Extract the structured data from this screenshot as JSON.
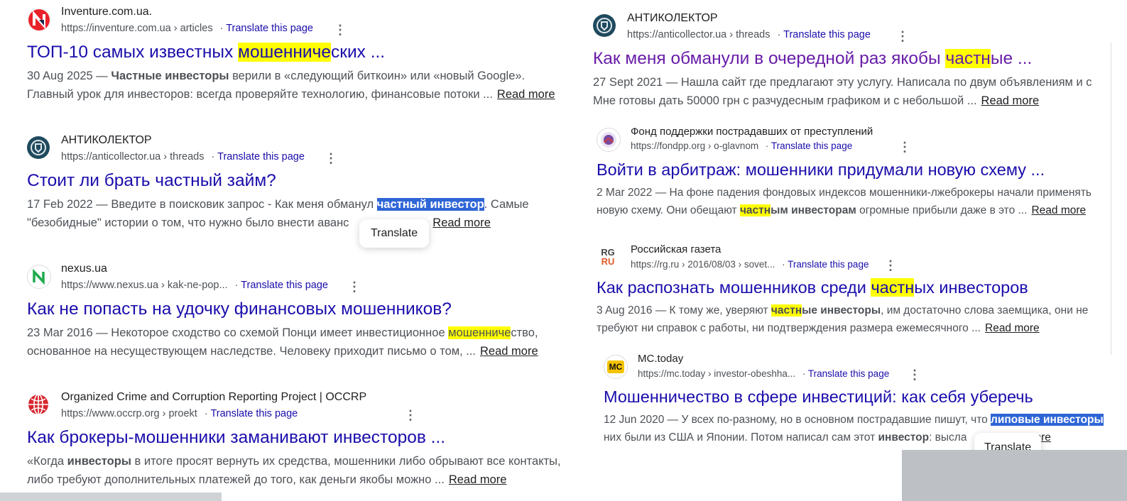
{
  "left": [
    {
      "site": "Inventure.com.ua.",
      "url": "https://inventure.com.ua › articles",
      "translate": "Translate this page",
      "title_pre": "ТОП-10 самых известных ",
      "title_hl": "мошенниче",
      "title_post": "ских ...",
      "s1_pre": "30 Aug 2025 — ",
      "s1_bold": "Частные инвесторы",
      "s1_post": " верили в «следующий биткоин» или «новый Google».",
      "s2": "Главный урок для инвесторов: всегда проверяйте технологию, финансовые потоки ...",
      "read_more": "Read more"
    },
    {
      "site": "АНТИКОЛЕКТОР",
      "url": "https://anticollector.ua › threads",
      "translate": "Translate this page",
      "title": "Стоит ли брать частный займ?",
      "s1_pre": "17 Feb 2022 — Введите в поисковик запрос - Как меня обманул ",
      "s1_sel": "частный инвестор",
      "s1_post": ". Самые",
      "s2": "\"безобидные\" истории о том, что нужно было внести аванс",
      "s2_tail": "ние ...",
      "read_more": "Read more",
      "tooltip": "Translate"
    },
    {
      "site": "nexus.ua",
      "url": "https://www.nexus.ua › kak-ne-pop...",
      "translate": "Translate this page",
      "title": "Как не попасть на удочку финансовых мошенников?",
      "s1_pre": "23 Mar 2016 — Некоторое сходство со схемой Понци имеет инвестиционное ",
      "s1_hl": "мошенниче",
      "s1_post": "ство,",
      "s2": "основанное на несуществующем наследстве. Человеку приходит письмо о том, ...",
      "read_more": "Read more"
    },
    {
      "site": "Organized Crime and Corruption Reporting Project | OCCRP",
      "url": "https://www.occrp.org › proekt",
      "translate": "Translate this page",
      "title": "Как брокеры-мошенники заманивают инвесторов ...",
      "s1_pre": "«Когда ",
      "s1_bold": "инвесторы",
      "s1_post": " в итоге просят вернуть их средства, мошенники либо обрывают все контакты,",
      "s2": "либо требуют дополнительных платежей до того, как деньги якобы можно ...",
      "read_more": "Read more"
    }
  ],
  "right": [
    {
      "site": "АНТИКОЛЕКТОР",
      "url": "https://anticollector.ua › threads",
      "translate": "Translate this page",
      "title_pre": "Как меня обманули в очередной раз якобы ",
      "title_hl": "частн",
      "title_post": "ые ...",
      "s1": "27 Sept 2021 — Нашла сайт где предлагают эту услугу. Написала по двум объявлениям и с",
      "s2": "Мне готовы дать 50000 грн с разчудесным графиком и с небольшой ...",
      "read_more": "Read more"
    },
    {
      "site": "Фонд поддержки пострадавших от преступлений",
      "url": "https://fondpp.org › o-glavnom",
      "translate": "Translate this page",
      "title": "Войти в арбитраж: мошенники придумали новую схему ...",
      "s1": "2 Mar 2022 — На фоне падения фондовых индексов мошенники-лжеброкеры начали применять",
      "s2_pre": "новую схему. Они обещают ",
      "s2_hl": "частн",
      "s2_bold": "ым инвесторам",
      "s2_post": " огромные прибыли даже в это ...",
      "read_more": "Read more"
    },
    {
      "site": "Российская газета",
      "url": "https://rg.ru › 2016/08/03 › sovet...",
      "translate": "Translate this page",
      "title_pre": "Как распознать мошенников среди ",
      "title_hl": "частн",
      "title_post": "ых инвесторов",
      "s1_pre": "3 Aug 2016 — К тому же, уверяют ",
      "s1_hl": "частн",
      "s1_bold": "ые инвесторы",
      "s1_post": ", им достаточно слова заемщика, они не",
      "s2": "требуют ни справок с работы, ни подтверждения размера ежемесячного ...",
      "read_more": "Read more"
    },
    {
      "site": "MC.today",
      "url": "https://mc.today › investor-obeshha...",
      "translate": "Translate this page",
      "title": "Мошенничество в сфере инвестиций: как себя уберечь",
      "s1_pre": "12 Jun 2020 — У всех по-разному, но в основном пострадавшие пишут, что ",
      "s1_sel": "липовые инвесторы",
      "s2_pre": "них были из США и Японии. Потом написал сам этот ",
      "s2_bold": "инвестор",
      "s2_post": ": высла",
      "read_more": "ore",
      "tooltip": "Translate"
    }
  ],
  "favicons": {
    "inventure": "N",
    "nexus": "N",
    "rg_top": "RG",
    "rg_bottom": "RU",
    "mc": "MC"
  }
}
